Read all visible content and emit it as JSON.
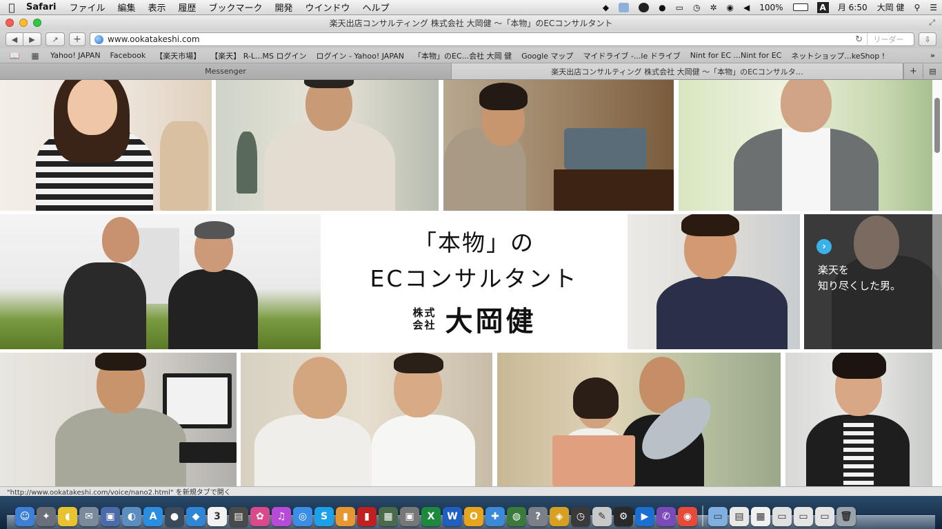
{
  "menubar": {
    "app_name": "Safari",
    "menus": [
      "ファイル",
      "編集",
      "表示",
      "履歴",
      "ブックマーク",
      "開発",
      "ウインドウ",
      "ヘルプ"
    ],
    "battery": "100%",
    "input_method": "A",
    "clock": "月 6:50",
    "user": "大岡 健"
  },
  "window": {
    "title": "楽天出店コンサルティング 株式会社 大岡健 〜「本物」のECコンサルタント"
  },
  "toolbar": {
    "url": "www.ookatakeshi.com",
    "reader_label": "リーダー"
  },
  "bookmarks": [
    "Yahoo! JAPAN",
    "Facebook",
    "【楽天市場】",
    "【楽天】 R-L...MS ログイン",
    "ログイン - Yahoo! JAPAN",
    "「本物」のEC...会社 大岡 健",
    "Google マップ",
    "マイドライブ -...le ドライブ",
    "Nint for EC ...Nint for EC",
    "ネットショップ...keShop !"
  ],
  "tabs": [
    {
      "label": "Messenger",
      "active": false
    },
    {
      "label": "楽天出店コンサルティング 株式会社 大岡健 〜「本物」のECコンサルタ…",
      "active": true
    }
  ],
  "hero": {
    "line1": "「本物」の",
    "line2": "ECコンサルタント",
    "prefix_top": "株式",
    "prefix_bottom": "会社",
    "name": "大岡健"
  },
  "feature_card": {
    "line1": "楽天を",
    "line2": "知り尽くした男。"
  },
  "status_text": "\"http://www.ookatakeshi.com/voice/nano2.html\" を新規タブで開く",
  "dock": [
    {
      "name": "finder-icon",
      "color": "#3d7fd6",
      "glyph": "☺"
    },
    {
      "name": "launchpad-icon",
      "color": "#6a6f7a",
      "glyph": "✦"
    },
    {
      "name": "cyberduck-icon",
      "color": "#e8c230",
      "glyph": "◖"
    },
    {
      "name": "mail-icon",
      "color": "#7a8a9a",
      "glyph": "✉"
    },
    {
      "name": "photo-browser-icon",
      "color": "#4a6aa8",
      "glyph": "▣"
    },
    {
      "name": "preview-icon",
      "color": "#5a8ec0",
      "glyph": "◐"
    },
    {
      "name": "app-store-icon",
      "color": "#2b8de0",
      "glyph": "A"
    },
    {
      "name": "facetime-icon",
      "color": "#3a4a5a",
      "glyph": "●"
    },
    {
      "name": "dropbox-icon",
      "color": "#2f86d6",
      "glyph": "◆"
    },
    {
      "name": "calendar-icon",
      "color": "#f2f2f2",
      "glyph": "3"
    },
    {
      "name": "notes-icon",
      "color": "#4a4a4a",
      "glyph": "▤"
    },
    {
      "name": "picasa-icon",
      "color": "#d94a8a",
      "glyph": "✿"
    },
    {
      "name": "itunes-icon",
      "color": "#b84ad8",
      "glyph": "♫"
    },
    {
      "name": "safari-icon",
      "color": "#3a8ee6",
      "glyph": "◎"
    },
    {
      "name": "skype-icon",
      "color": "#1ea0e8",
      "glyph": "S"
    },
    {
      "name": "ibooks-icon",
      "color": "#e89630",
      "glyph": "▮"
    },
    {
      "name": "book-icon",
      "color": "#c02020",
      "glyph": "▮"
    },
    {
      "name": "photo-icon",
      "color": "#4a6a4a",
      "glyph": "▦"
    },
    {
      "name": "screenshot-icon",
      "color": "#777777",
      "glyph": "▣"
    },
    {
      "name": "excel-icon",
      "color": "#1c8a3a",
      "glyph": "X"
    },
    {
      "name": "word-icon",
      "color": "#1f5fbf",
      "glyph": "W"
    },
    {
      "name": "outlook-icon",
      "color": "#e6a51c",
      "glyph": "O"
    },
    {
      "name": "messenger-icon",
      "color": "#3a8ad8",
      "glyph": "✚"
    },
    {
      "name": "network-icon",
      "color": "#3a7a3a",
      "glyph": "◍"
    },
    {
      "name": "help-icon",
      "color": "#7a7f88",
      "glyph": "?"
    },
    {
      "name": "shield-icon",
      "color": "#d8a020",
      "glyph": "◈"
    },
    {
      "name": "clock-icon",
      "color": "#3a3a3a",
      "glyph": "◷"
    },
    {
      "name": "sketch-icon",
      "color": "#c8c8c8",
      "glyph": "✎"
    },
    {
      "name": "system-icon",
      "color": "#2a2a2a",
      "glyph": "⚙"
    },
    {
      "name": "video-icon",
      "color": "#1a6fd0",
      "glyph": "▶"
    },
    {
      "name": "viber-icon",
      "color": "#7a4ab8",
      "glyph": "✆"
    },
    {
      "name": "chrome-icon",
      "color": "#e84a3a",
      "glyph": "◉"
    }
  ],
  "dock_right": [
    {
      "name": "folder-icon",
      "color": "#7fb0e0",
      "glyph": "▭"
    },
    {
      "name": "document-stack-icon",
      "color": "#e8e8e8",
      "glyph": "▤"
    },
    {
      "name": "spreadsheet-stack-icon",
      "color": "#f0f0f0",
      "glyph": "▦"
    },
    {
      "name": "document-icon",
      "color": "#e0e0e0",
      "glyph": "▭"
    },
    {
      "name": "screenshot-stack-icon",
      "color": "#e4e4e4",
      "glyph": "▭"
    },
    {
      "name": "image-stack-icon",
      "color": "#e4e4e4",
      "glyph": "▭"
    },
    {
      "name": "trash-icon",
      "color": "#9aa2aa",
      "glyph": "🗑"
    }
  ]
}
